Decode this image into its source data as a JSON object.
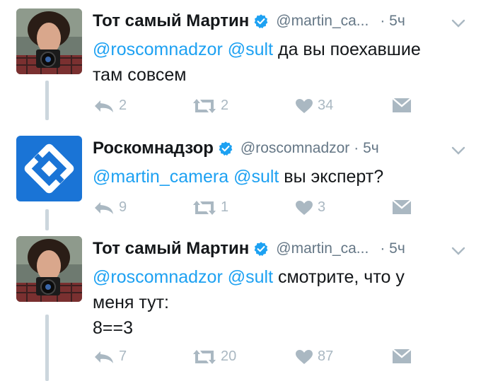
{
  "tweets": [
    {
      "name": "Тот самый Мартин",
      "handle": "@martin_ca...",
      "time": "· 5ч",
      "mention1": "@roscomnadzor",
      "mention2": "@sult",
      "text": " да вы поехавшие",
      "text2": "там совсем",
      "replies": "2",
      "retweets": "2",
      "likes": "34",
      "avatar": "photographer-avatar"
    },
    {
      "name": "Роскомнадзор",
      "handle": "@roscomnadzor",
      "time": "· 5ч",
      "mention1": "@martin_camera",
      "mention2": "@sult",
      "text": " вы эксперт?",
      "replies": "9",
      "retweets": "1",
      "likes": "3",
      "avatar": "roskomnadzor-logo"
    },
    {
      "name": "Тот самый Мартин",
      "handle": "@martin_ca...",
      "time": "· 5ч",
      "mention1": "@roscomnadzor",
      "mention2": "@sult",
      "text": " смотрите, что у",
      "text2": "меня тут:",
      "text3": "8==3",
      "replies": "7",
      "retweets": "20",
      "likes": "87",
      "avatar": "photographer-avatar"
    }
  ],
  "colors": {
    "link": "#1da1f2",
    "muted": "#657786",
    "action": "#aab8c2",
    "thread_line": "#ccd6dd",
    "verified": "#1da1f2",
    "rkn_blue": "#1a74d6"
  }
}
